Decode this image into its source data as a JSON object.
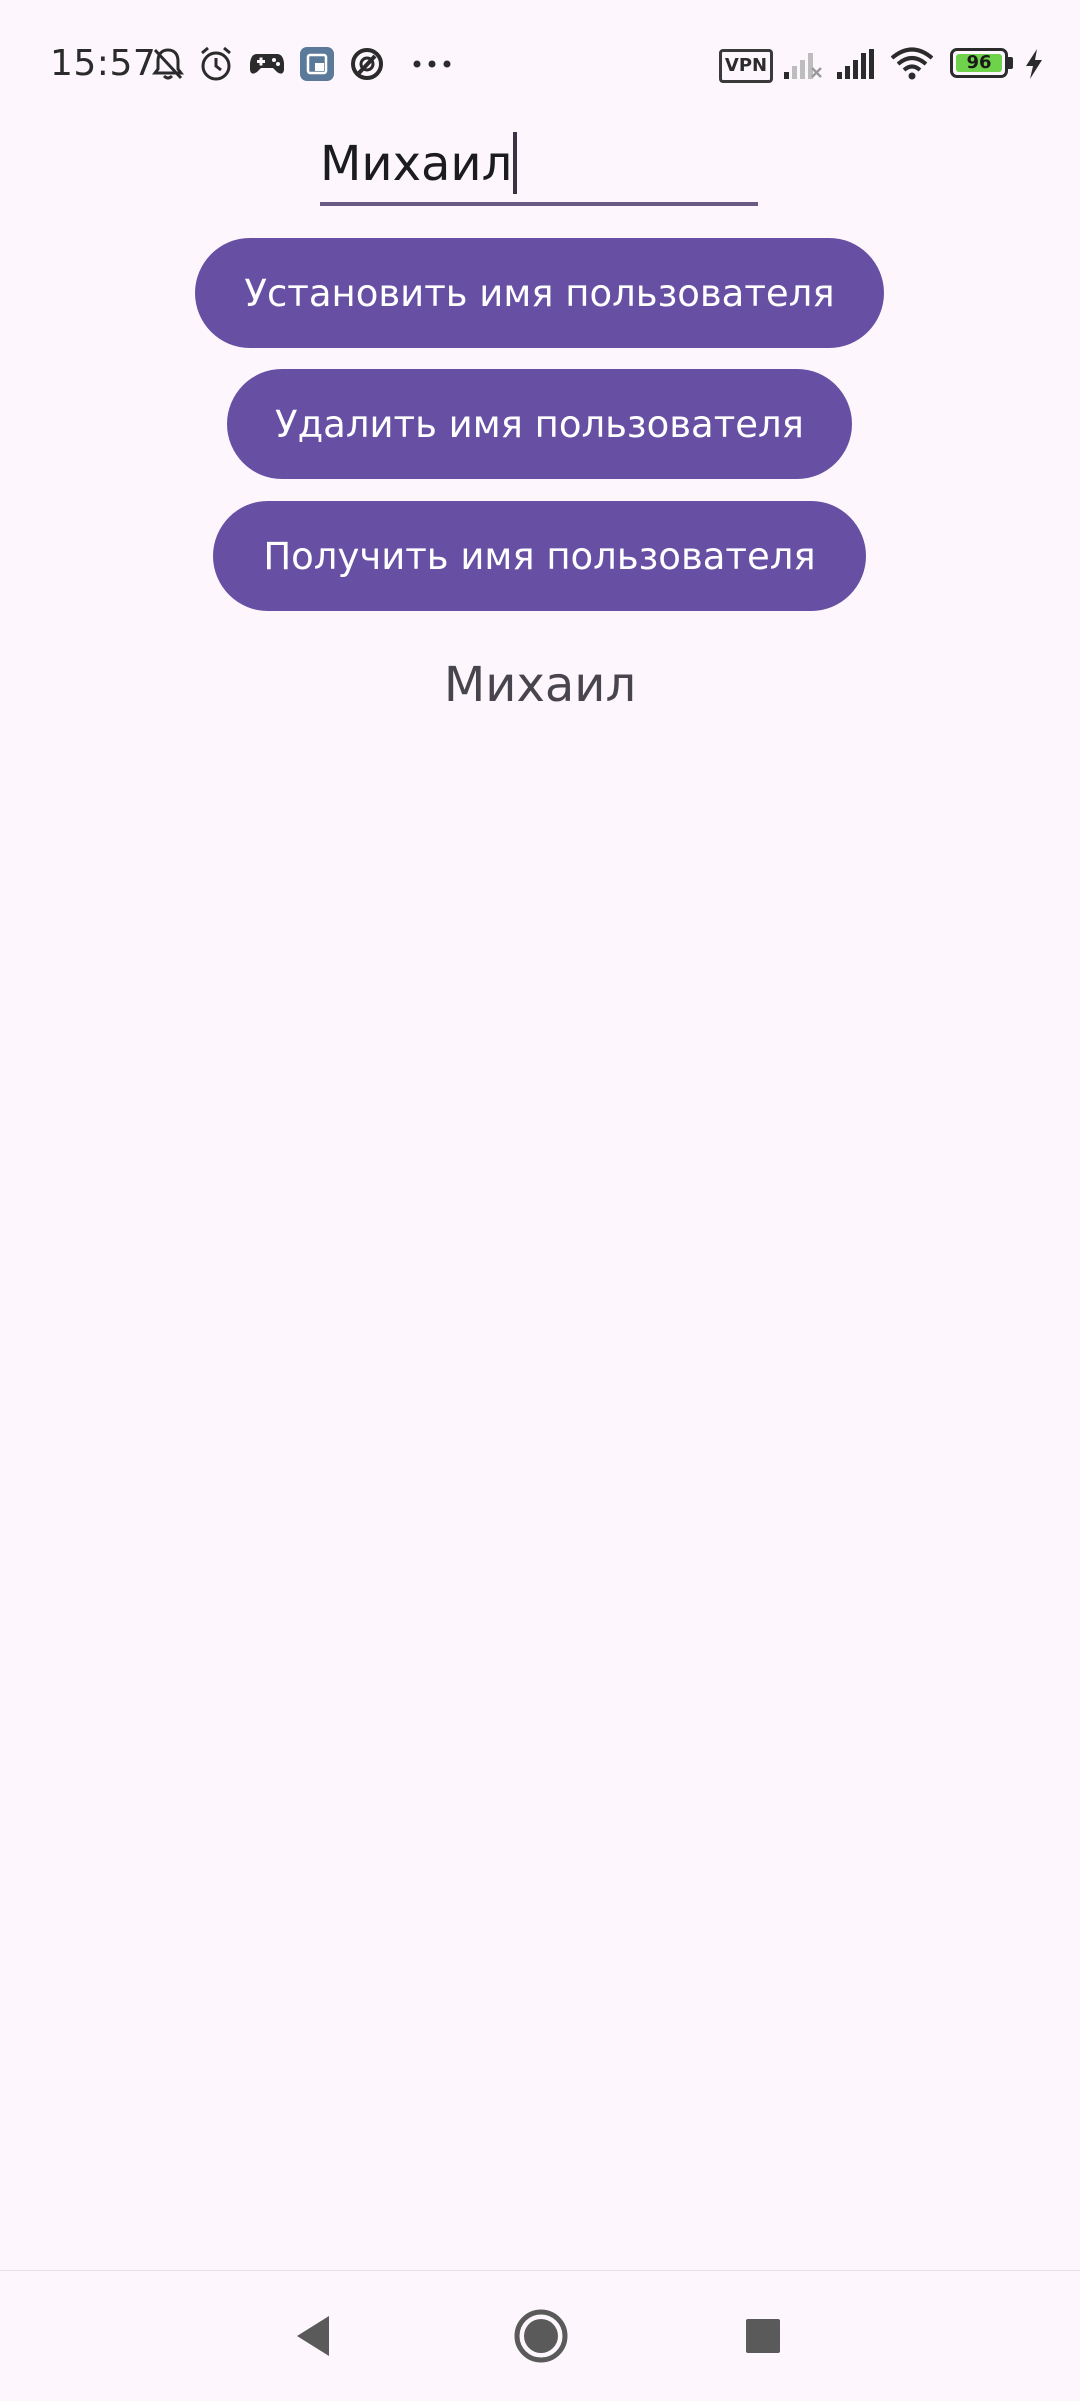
{
  "status_bar": {
    "time": "15:57",
    "vpn_label": "VPN",
    "battery_level": "96",
    "icons": [
      "bell-off-icon",
      "alarm-icon",
      "gamepad-icon",
      "app-notification-icon",
      "data-saver-icon",
      "more-dots-icon",
      "vpn-icon",
      "signal-1-icon",
      "signal-2-icon",
      "wifi-icon",
      "battery-icon",
      "charging-bolt-icon"
    ]
  },
  "form": {
    "name_input_value": "Михаил"
  },
  "buttons": {
    "set_username": "Установить имя пользователя",
    "delete_username": "Удалить имя пользователя",
    "get_username": "Получить имя пользователя"
  },
  "result": {
    "username_text": "Михаил"
  },
  "navigation": {
    "icons": [
      "back-icon",
      "home-icon",
      "recents-icon"
    ]
  },
  "colors": {
    "background": "#fdf7fd",
    "button": "#6750a4",
    "button_text": "#ffffff",
    "underline": "#6a5a86",
    "battery_fill": "#6fd24b"
  }
}
